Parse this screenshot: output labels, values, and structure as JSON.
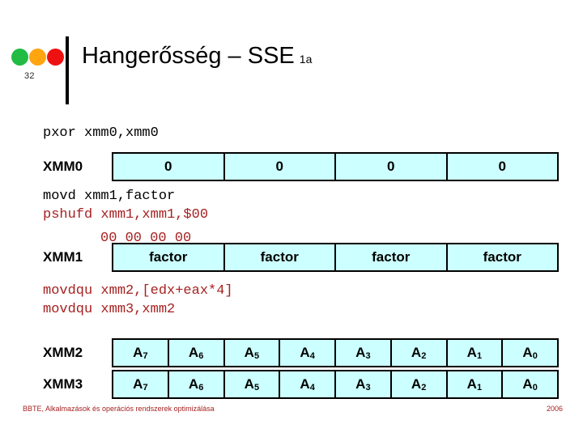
{
  "header": {
    "slide_number": "32",
    "title": "Hangerősség – SSE",
    "title_suffix": "1a",
    "dots": [
      {
        "name": "status-dot-green",
        "color": "#22BB44"
      },
      {
        "name": "status-dot-orange",
        "color": "#FFA510"
      },
      {
        "name": "status-dot-red",
        "color": "#EE1111"
      }
    ]
  },
  "colors": {
    "cell_fill": "#CCFFFF",
    "border": "#000000",
    "code_black": "#000000",
    "code_red": "#A62121",
    "footer_red": "#A62121"
  },
  "code": {
    "pxor": "pxor xmm0,xmm0",
    "movd": "movd xmm1,factor",
    "pshufd": "pshufd xmm1,xmm1,$00",
    "pshufd_cont": "00 00 00 00",
    "movdqu1": "movdqu xmm2,[edx+eax*4]",
    "movdqu2": "movdqu xmm3,xmm2"
  },
  "registers": [
    {
      "label": "XMM0",
      "cells": [
        {
          "text": "0",
          "sub": ""
        },
        {
          "text": "0",
          "sub": ""
        },
        {
          "text": "0",
          "sub": ""
        },
        {
          "text": "0",
          "sub": ""
        }
      ]
    },
    {
      "label": "XMM1",
      "cells": [
        {
          "text": "factor",
          "sub": ""
        },
        {
          "text": "factor",
          "sub": ""
        },
        {
          "text": "factor",
          "sub": ""
        },
        {
          "text": "factor",
          "sub": ""
        }
      ]
    },
    {
      "label": "XMM2",
      "cells": [
        {
          "text": "A",
          "sub": "7"
        },
        {
          "text": "A",
          "sub": "6"
        },
        {
          "text": "A",
          "sub": "5"
        },
        {
          "text": "A",
          "sub": "4"
        },
        {
          "text": "A",
          "sub": "3"
        },
        {
          "text": "A",
          "sub": "2"
        },
        {
          "text": "A",
          "sub": "1"
        },
        {
          "text": "A",
          "sub": "0"
        }
      ]
    },
    {
      "label": "XMM3",
      "cells": [
        {
          "text": "A",
          "sub": "7"
        },
        {
          "text": "A",
          "sub": "6"
        },
        {
          "text": "A",
          "sub": "5"
        },
        {
          "text": "A",
          "sub": "4"
        },
        {
          "text": "A",
          "sub": "3"
        },
        {
          "text": "A",
          "sub": "2"
        },
        {
          "text": "A",
          "sub": "1"
        },
        {
          "text": "A",
          "sub": "0"
        }
      ]
    }
  ],
  "footer": {
    "left": "BBTE, Alkalmazások és operációs rendszerek optimizálása",
    "right": "2006"
  }
}
